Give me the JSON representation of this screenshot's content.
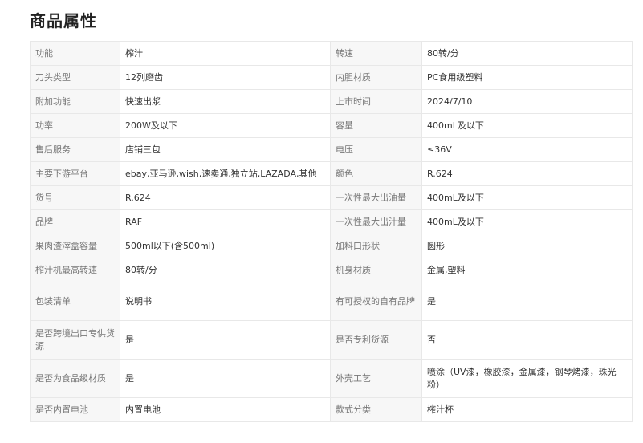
{
  "section_title": "商品属性",
  "rows": [
    {
      "k1": "功能",
      "v1": "榨汁",
      "k2": "转速",
      "v2": "80转/分"
    },
    {
      "k1": "刀头类型",
      "v1": "12列磨齿",
      "k2": "内胆材质",
      "v2": "PC食用级塑料"
    },
    {
      "k1": "附加功能",
      "v1": "快速出浆",
      "k2": "上市时间",
      "v2": "2024/7/10"
    },
    {
      "k1": "功率",
      "v1": "200W及以下",
      "k2": "容量",
      "v2": "400mL及以下"
    },
    {
      "k1": "售后服务",
      "v1": "店铺三包",
      "k2": "电压",
      "v2": "≤36V"
    },
    {
      "k1": "主要下游平台",
      "v1": "ebay,亚马逊,wish,速卖通,独立站,LAZADA,其他",
      "k2": "颜色",
      "v2": "R.624"
    },
    {
      "k1": "货号",
      "v1": "R.624",
      "k2": "一次性最大出油量",
      "v2": "400mL及以下"
    },
    {
      "k1": "品牌",
      "v1": "RAF",
      "k2": "一次性最大出汁量",
      "v2": "400mL及以下"
    },
    {
      "k1": "果肉渣滓盒容量",
      "v1": "500ml以下(含500ml)",
      "k2": "加料口形状",
      "v2": "圆形"
    },
    {
      "k1": "榨汁机最高转速",
      "v1": "80转/分",
      "k2": "机身材质",
      "v2": "金属,塑料"
    },
    {
      "k1": "包装清单",
      "v1": "说明书",
      "k2": "有可授权的自有品牌",
      "v2": "是"
    },
    {
      "k1": "是否跨境出口专供货源",
      "v1": "是",
      "k2": "是否专利货源",
      "v2": "否"
    },
    {
      "k1": "是否为食品级材质",
      "v1": "是",
      "k2": "外壳工艺",
      "v2": "喷涂（UV漆，橡胶漆，金属漆，钢琴烤漆，珠光粉）"
    },
    {
      "k1": "是否内置电池",
      "v1": "内置电池",
      "k2": "款式分类",
      "v2": "榨汁杯"
    }
  ]
}
